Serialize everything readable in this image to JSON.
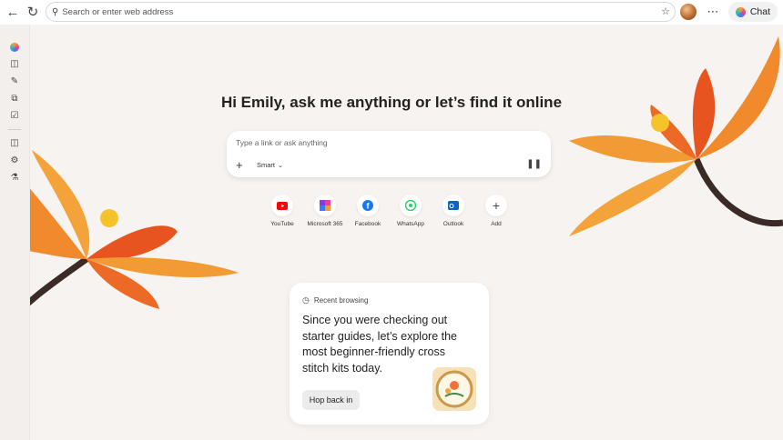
{
  "toolbar": {
    "address_placeholder": "Search or enter web address",
    "chat_label": "Chat"
  },
  "heading": "Hi Emily, ask me anything or let’s find it online",
  "prompt": {
    "placeholder": "Type a link or ask anything",
    "mode_label": "Smart"
  },
  "quick_links": [
    {
      "label": "YouTube",
      "icon": "youtube-icon",
      "color": "#ff0000"
    },
    {
      "label": "Microsoft 365",
      "icon": "microsoft-365-icon",
      "color": "#7b3fe4"
    },
    {
      "label": "Facebook",
      "icon": "facebook-icon",
      "color": "#1877f2"
    },
    {
      "label": "WhatsApp",
      "icon": "whatsapp-icon",
      "color": "#25d366"
    },
    {
      "label": "Outlook",
      "icon": "outlook-icon",
      "color": "#0a64c2"
    },
    {
      "label": "Add",
      "icon": "add-icon",
      "color": "#444444"
    }
  ],
  "card": {
    "tag": "Recent browsing",
    "text": "Since you were checking out starter guides, let’s explore the most beginner-friendly cross stitch kits today.",
    "button_label": "Hop back in"
  },
  "colors": {
    "accent": "#f28a2e",
    "background": "#f7f3f1"
  }
}
